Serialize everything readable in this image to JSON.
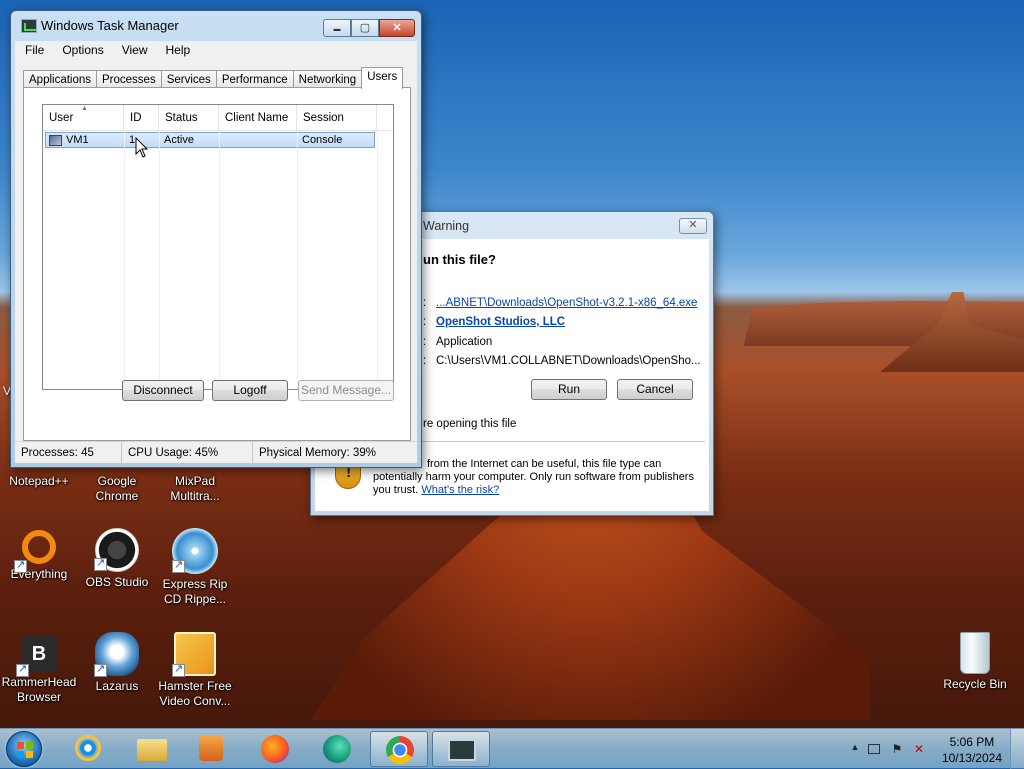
{
  "desktop": {
    "icons": [
      {
        "id": "notepad",
        "label": "Notepad++"
      },
      {
        "id": "chrome",
        "label": "Google Chrome"
      },
      {
        "id": "mixpad",
        "label": "MixPad Multitra..."
      },
      {
        "id": "everything",
        "label": "Everything"
      },
      {
        "id": "obs",
        "label": "OBS Studio"
      },
      {
        "id": "expressrip",
        "label": "Express Rip CD Rippe..."
      },
      {
        "id": "rammerhead",
        "label": "RammerHead Browser",
        "glyph": "B"
      },
      {
        "id": "lazarus",
        "label": "Lazarus"
      },
      {
        "id": "hamster",
        "label": "Hamster Free Video Conv..."
      },
      {
        "id": "recyclebin",
        "label": "Recycle Bin"
      }
    ],
    "partial_label": "V"
  },
  "task_manager": {
    "title": "Windows Task Manager",
    "buttons": {
      "minimize": "▬",
      "maximize": "▢",
      "close": "✕"
    },
    "menu": [
      "File",
      "Options",
      "View",
      "Help"
    ],
    "tabs": [
      "Applications",
      "Processes",
      "Services",
      "Performance",
      "Networking",
      "Users"
    ],
    "active_tab": "Users",
    "columns": [
      "User",
      "ID",
      "Status",
      "Client Name",
      "Session"
    ],
    "sort_indicator": "▲",
    "rows": [
      {
        "user": "VM1",
        "id": "1",
        "status": "Active",
        "client_name": "",
        "session": "Console"
      }
    ],
    "actions": {
      "disconnect": "Disconnect",
      "logoff": "Logoff",
      "send_message": "Send Message..."
    },
    "status": {
      "processes": "Processes: 45",
      "cpu": "CPU Usage: 45%",
      "memory": "Physical Memory: 39%"
    }
  },
  "security_warning": {
    "title_visible": "Warning",
    "close_glyph": "✕",
    "question": "un this file?",
    "name_link": "...ABNET\\Downloads\\OpenShot-v3.2.1-x86_64.exe",
    "publisher_link": "OpenShot Studios, LLC",
    "type": "Application",
    "from": "C:\\Users\\VM1.COLLABNET\\Downloads\\OpenSho...",
    "colon": ":",
    "run_label": "Run",
    "cancel_label": "Cancel",
    "ask_text": "re opening this file",
    "warning_line1": "from the Internet can be useful, this file type can",
    "warning_line2": "potentially harm your computer. Only run software from publishers",
    "warning_line3_prefix": "you trust.",
    "risk_link": "What's the risk?",
    "shield_glyph": "!"
  },
  "taskbar": {
    "items": [
      "internet-explorer",
      "file-explorer",
      "media-player",
      "firefox",
      "edge",
      "chrome",
      "task-manager"
    ],
    "active_items": [
      "chrome",
      "task-manager"
    ],
    "tray": {
      "time": "5:06 PM",
      "date": "10/13/2024",
      "show_hidden": "▲"
    }
  },
  "colors": {
    "accent": "#3399ff",
    "link": "#0645ad",
    "selection": "#c2dcf7"
  }
}
